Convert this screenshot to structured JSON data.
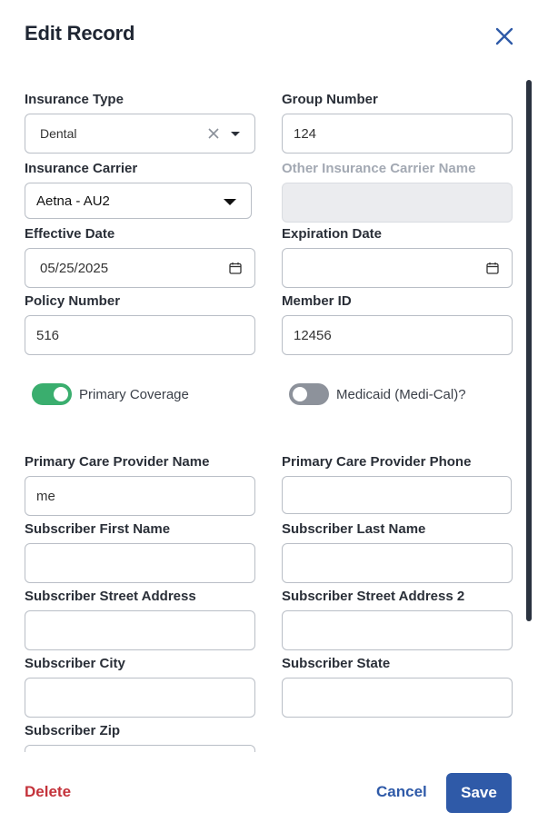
{
  "dialog": {
    "title": "Edit Record"
  },
  "icons": {
    "close": "close-icon",
    "clear": "clear-icon",
    "dropdown": "chevron-down-icon",
    "calendar": "calendar-icon"
  },
  "colors": {
    "accent": "#2f5aa8",
    "danger": "#c4333b",
    "toggle_on": "#3aae6e",
    "toggle_off": "#8d929b"
  },
  "fields": {
    "insurance_type": {
      "label": "Insurance Type",
      "value": "Dental"
    },
    "group_number": {
      "label": "Group Number",
      "value": "124"
    },
    "insurance_carrier": {
      "label": "Insurance Carrier",
      "value": "Aetna - AU2"
    },
    "other_carrier": {
      "label": "Other Insurance Carrier Name",
      "value": ""
    },
    "effective_date": {
      "label": "Effective Date",
      "value": "05/25/2025"
    },
    "expiration_date": {
      "label": "Expiration Date",
      "value": ""
    },
    "policy_number": {
      "label": "Policy Number",
      "value": "516"
    },
    "member_id": {
      "label": "Member ID",
      "value": "12456"
    },
    "pcp_name": {
      "label": "Primary Care Provider Name",
      "value": "me"
    },
    "pcp_phone": {
      "label": "Primary Care Provider Phone",
      "value": ""
    },
    "sub_first": {
      "label": "Subscriber First Name",
      "value": ""
    },
    "sub_last": {
      "label": "Subscriber Last Name",
      "value": ""
    },
    "sub_street": {
      "label": "Subscriber Street Address",
      "value": ""
    },
    "sub_street2": {
      "label": "Subscriber Street Address 2",
      "value": ""
    },
    "sub_city": {
      "label": "Subscriber City",
      "value": ""
    },
    "sub_state": {
      "label": "Subscriber State",
      "value": ""
    },
    "sub_zip": {
      "label": "Subscriber Zip",
      "value": ""
    }
  },
  "toggles": {
    "primary_coverage": {
      "label": "Primary Coverage",
      "on": true
    },
    "medicaid": {
      "label": "Medicaid (Medi-Cal)?",
      "on": false
    }
  },
  "footer": {
    "delete_label": "Delete",
    "cancel_label": "Cancel",
    "save_label": "Save"
  }
}
